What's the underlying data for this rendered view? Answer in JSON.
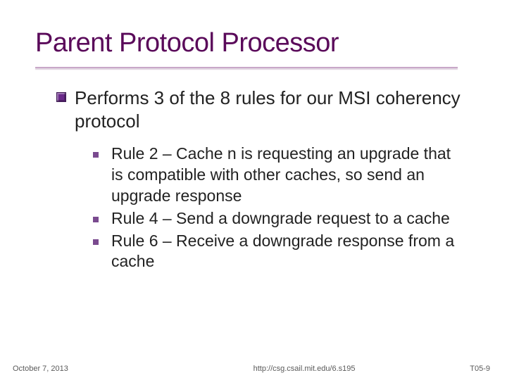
{
  "title": "Parent Protocol Processor",
  "main_bullet": "Performs 3 of the 8 rules for our MSI coherency protocol",
  "sub": [
    "Rule 2 – Cache n is requesting an upgrade that is compatible with other caches, so send an upgrade response",
    "Rule 4 – Send a downgrade request to a cache",
    "Rule 6 – Receive a downgrade response from a cache"
  ],
  "footer": {
    "date": "October 7, 2013",
    "url": "http://csg.csail.mit.edu/6.s195",
    "slide_num": "T05-9"
  }
}
